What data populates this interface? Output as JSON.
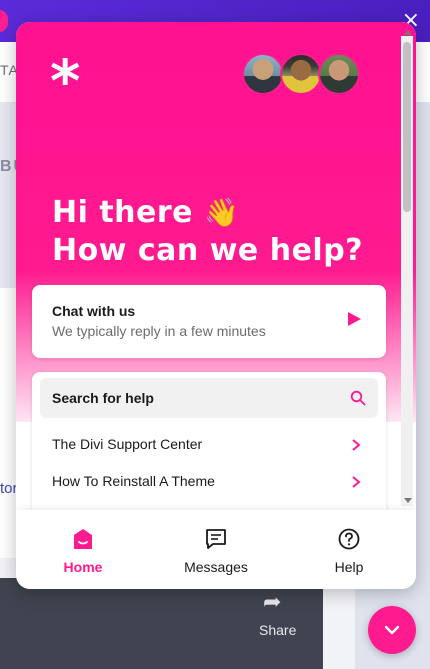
{
  "background": {
    "top_fragment": "TAG",
    "section_fragment": "BU",
    "link_fragment": "tor",
    "share_label": "Share"
  },
  "widget": {
    "logo": "*",
    "greeting_line1": "Hi there",
    "wave_emoji": "👋",
    "greeting_line2": "How can we help?",
    "avatars": [
      {
        "alt": "team member 1"
      },
      {
        "alt": "team member 2"
      },
      {
        "alt": "team member 3"
      }
    ],
    "chat": {
      "title": "Chat with us",
      "subtitle": "We typically reply in a few minutes"
    },
    "search": {
      "placeholder": "Search for help"
    },
    "help_articles": [
      {
        "label": "The Divi Support Center"
      },
      {
        "label": "How To Reinstall A Theme"
      }
    ],
    "nav": [
      {
        "label": "Home",
        "icon": "home-icon",
        "active": true
      },
      {
        "label": "Messages",
        "icon": "messages-icon",
        "active": false
      },
      {
        "label": "Help",
        "icon": "help-icon",
        "active": false
      }
    ]
  },
  "colors": {
    "accent": "#ff1a8f",
    "topbar": "#5b2bd8"
  },
  "icons": {
    "close": "×",
    "launcher": "chevron-down-icon"
  }
}
